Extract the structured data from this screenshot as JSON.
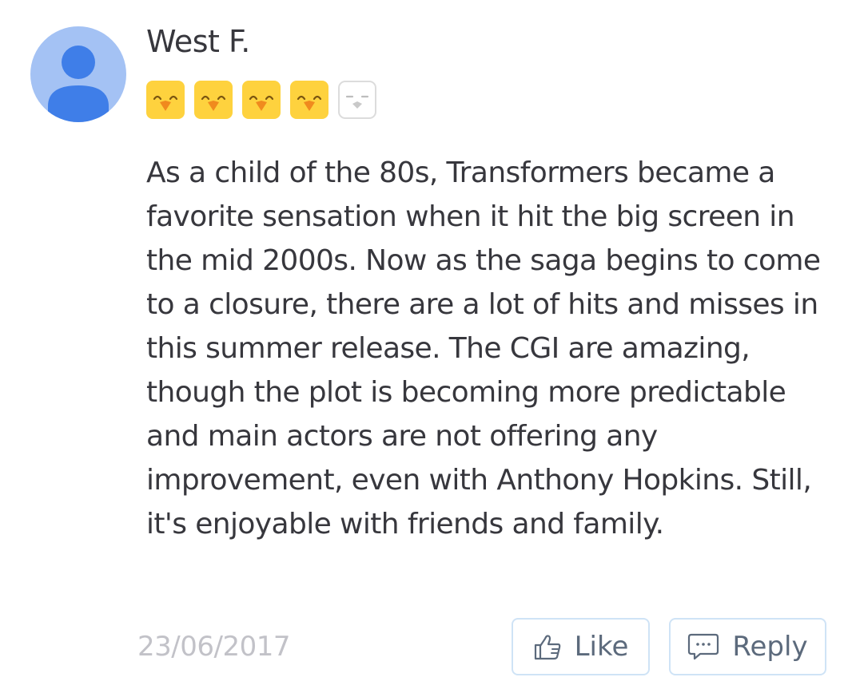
{
  "review": {
    "author": "West F.",
    "rating": {
      "value": 4,
      "max": 5
    },
    "text": "As a child of the 80s, Transformers became a favorite sensation when it hit the big screen in the mid 2000s. Now as the saga begins to come to a closure, there are a lot of hits and misses in this summer release. The CGI are amazing, though the plot is becoming more predictable and main actors are not offering any improvement, even with Anthony Hopkins. Still, it's enjoyable with friends and family.",
    "date": "23/06/2017"
  },
  "actions": {
    "like_label": "Like",
    "reply_label": "Reply"
  },
  "icons": {
    "avatar": "default-user-avatar-icon",
    "rating_filled": "happy-chick-icon",
    "rating_empty": "empty-chick-icon",
    "like": "thumbs-up-icon",
    "reply": "chat-bubble-icon"
  },
  "colors": {
    "avatar_bg": "#a4c2f4",
    "avatar_figure": "#3f7ee8",
    "rating_filled": "#fed23e",
    "rating_beak": "#f08a1e",
    "text": "#37373d",
    "date": "#c2c2c8",
    "button_border": "#cfe3f6",
    "button_text": "#5c6a7c"
  }
}
